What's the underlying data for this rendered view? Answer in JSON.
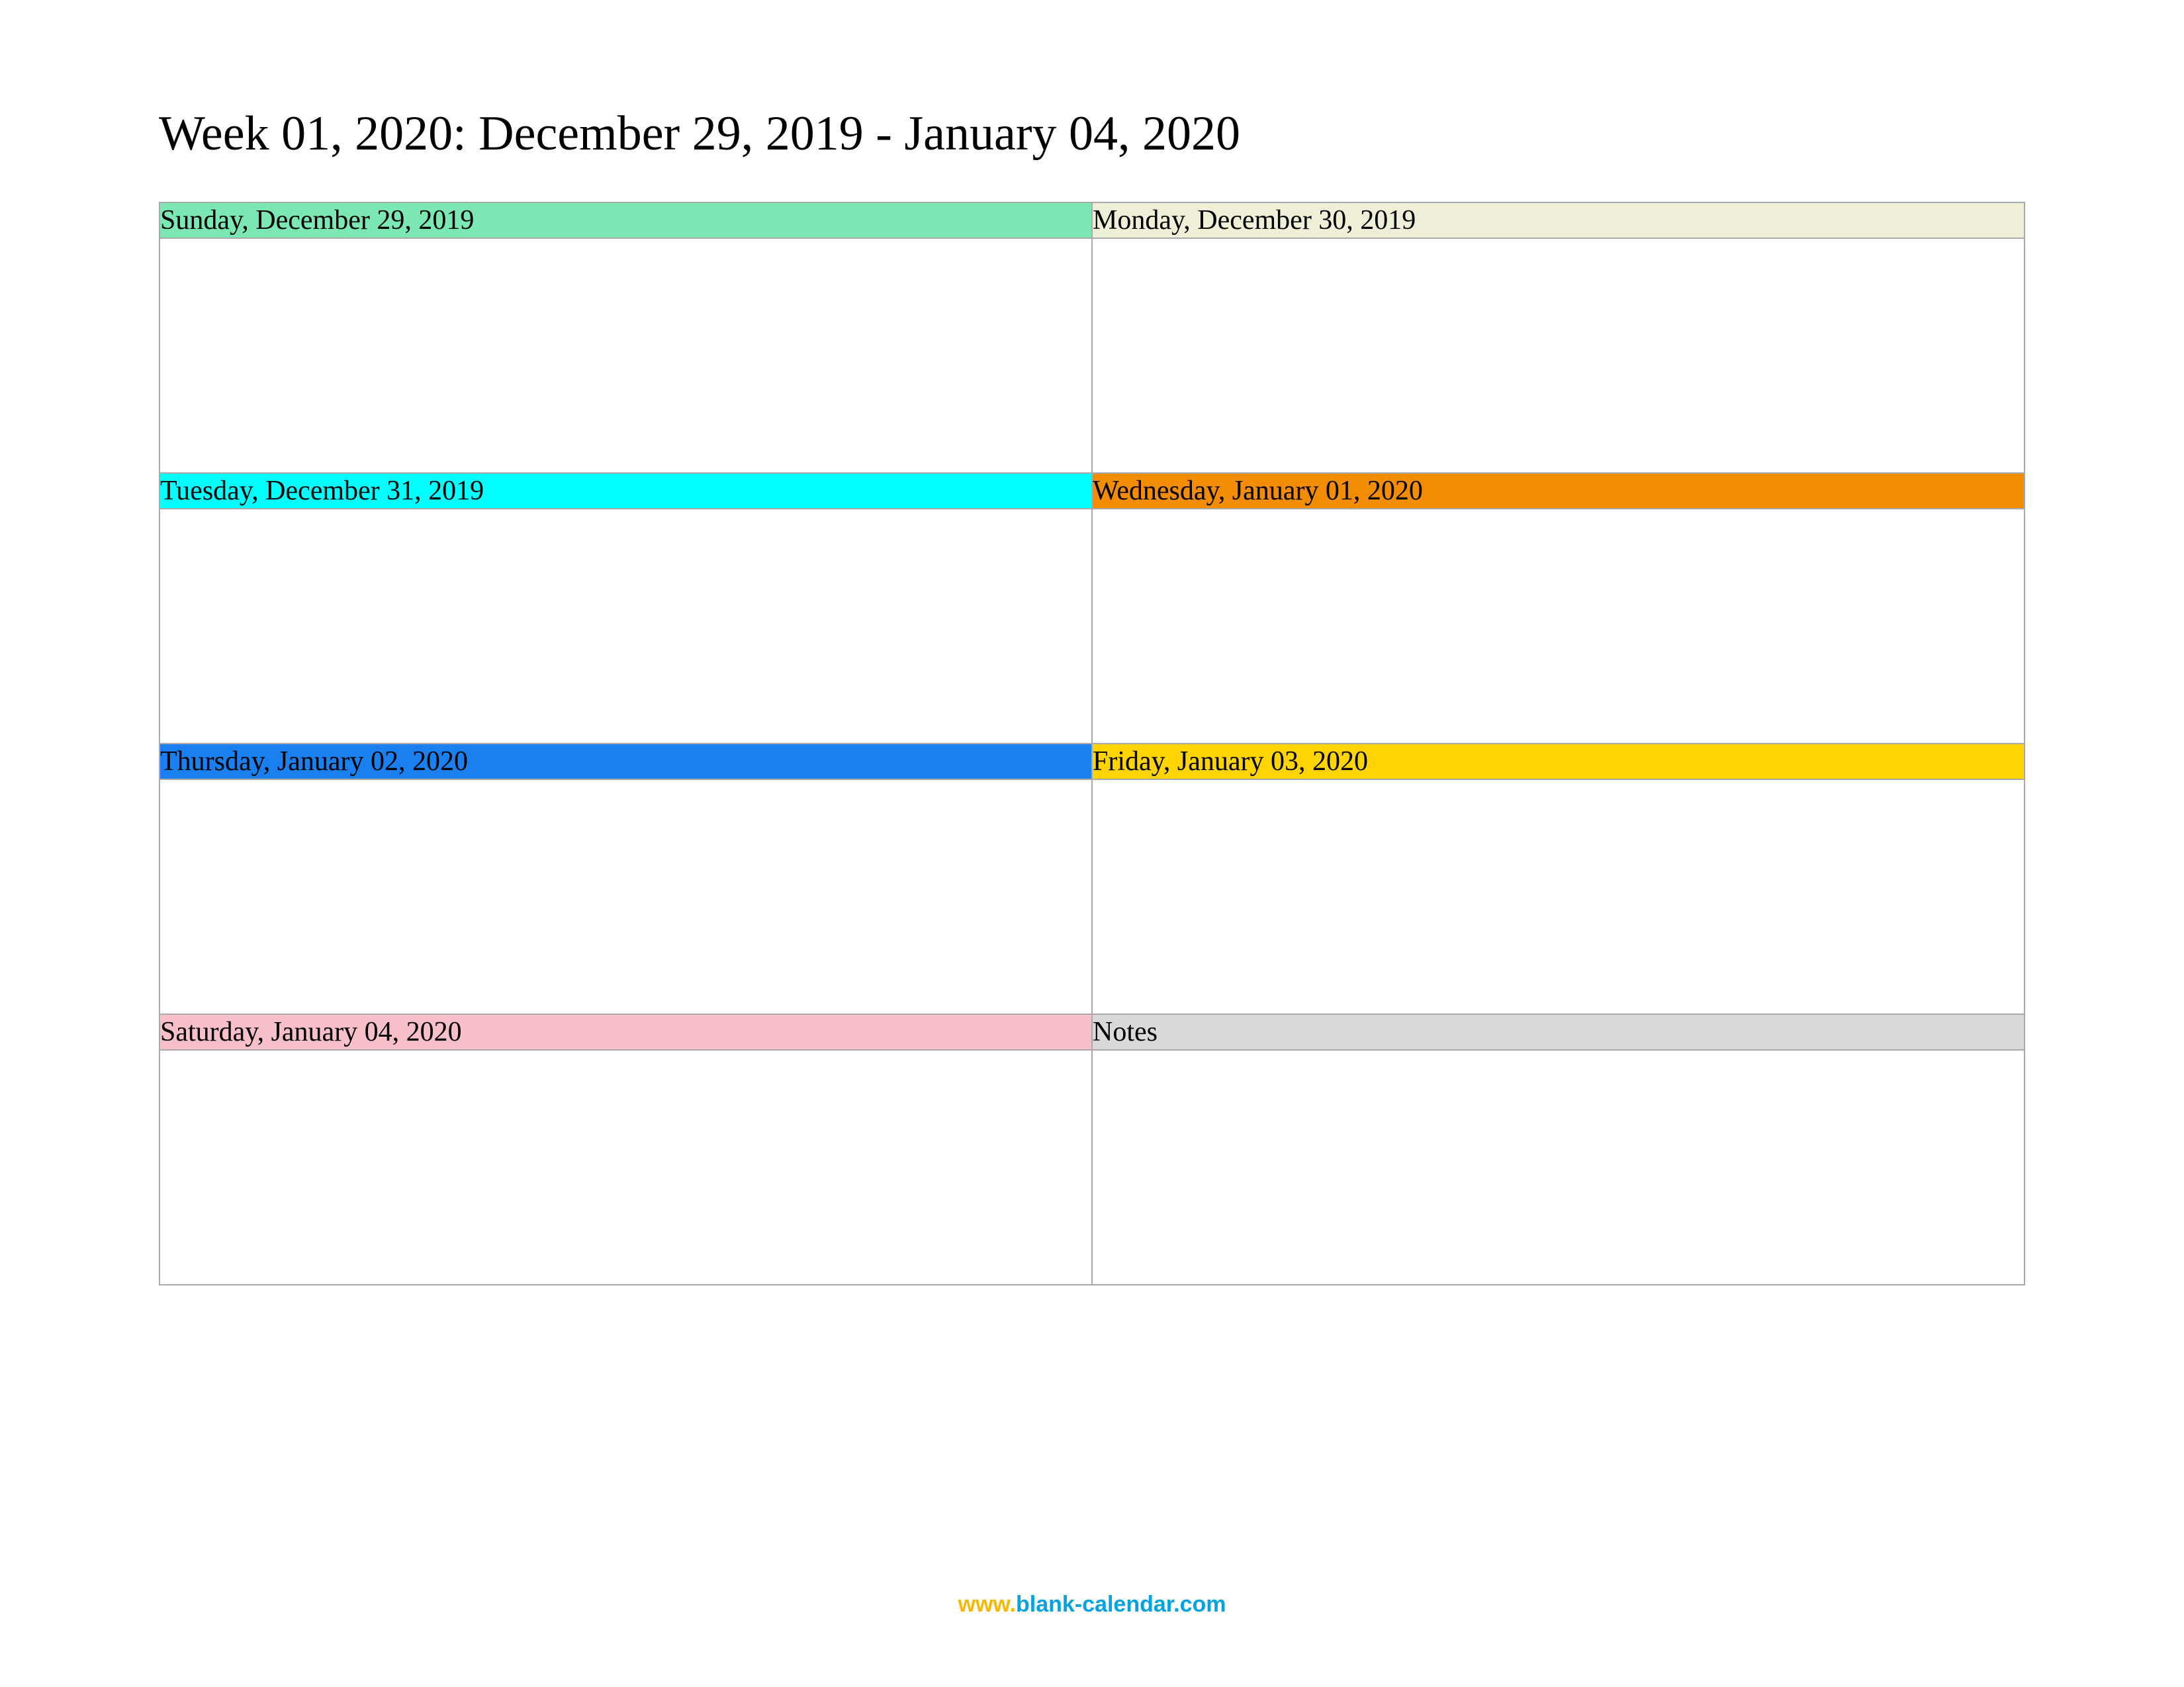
{
  "title": "Week 01, 2020: December 29, 2019 - January 04, 2020",
  "calendar": {
    "cells": [
      {
        "label": "Sunday, December 29, 2019",
        "bg": "#7be8b4"
      },
      {
        "label": "Monday, December 30, 2019",
        "bg": "#efeed7"
      },
      {
        "label": "Tuesday, December 31, 2019",
        "bg": "#00ffff"
      },
      {
        "label": "Wednesday, January 01, 2020",
        "bg": "#f28c00"
      },
      {
        "label": "Thursday, January 02, 2020",
        "bg": "#1a80f0"
      },
      {
        "label": "Friday, January 03, 2020",
        "bg": "#ffd400"
      },
      {
        "label": "Saturday, January 04, 2020",
        "bg": "#f7bfc9"
      },
      {
        "label": "Notes",
        "bg": "#d9d9d9"
      }
    ]
  },
  "footer": {
    "prefix": "www.",
    "rest": "blank-calendar.com"
  }
}
